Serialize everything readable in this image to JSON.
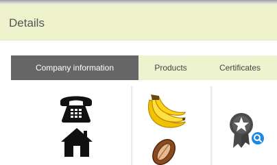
{
  "header": {
    "title": "Details"
  },
  "tabs": [
    {
      "label": "Company information",
      "active": true
    },
    {
      "label": "Products",
      "active": false
    },
    {
      "label": "Certificates",
      "active": false
    }
  ],
  "columns": {
    "company": {
      "icons": [
        "telephone-icon",
        "house-icon"
      ]
    },
    "products": {
      "icons": [
        "banana-icon",
        "cocoa-bean-icon"
      ]
    },
    "certificates": {
      "icons": [
        "certificate-badge-icon"
      ]
    }
  },
  "colors": {
    "header_bg": "#edf2cd",
    "active_tab_bg": "#666666",
    "badge_blue": "#1e88e5"
  }
}
